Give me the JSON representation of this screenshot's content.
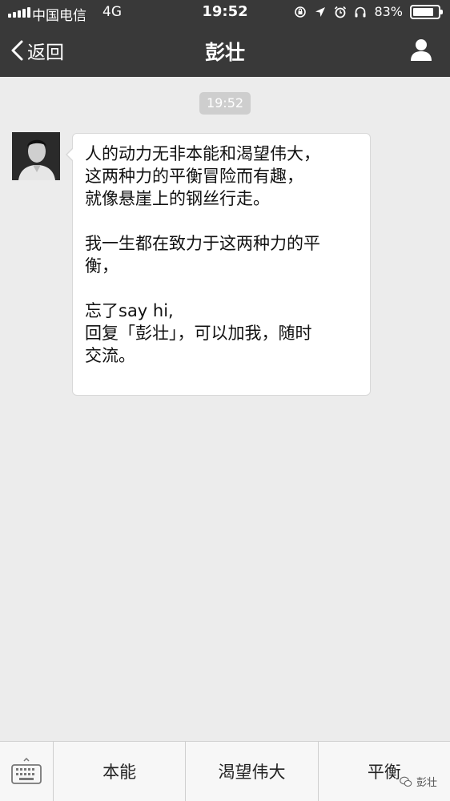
{
  "status_bar": {
    "carrier": "中国电信",
    "network": "4G",
    "time": "19:52",
    "battery": "83%",
    "battery_level": 0.83
  },
  "nav": {
    "back_label": "返回",
    "title": "彭壮"
  },
  "chat": {
    "timestamp": "19:52",
    "message_lines": [
      "人的动力无非本能和渴望伟大，",
      "这两种力的平衡冒险而有趣，",
      "就像悬崖上的钢丝行走。",
      "",
      "我一生都在致力于这两种力的平",
      "衡，",
      "",
      "忘了say hi,",
      "回复「彭壮」，可以加我，随时",
      "交流。"
    ]
  },
  "menu": {
    "items": [
      "本能",
      "渴望伟大",
      "平衡"
    ]
  },
  "watermark": "彭壮"
}
